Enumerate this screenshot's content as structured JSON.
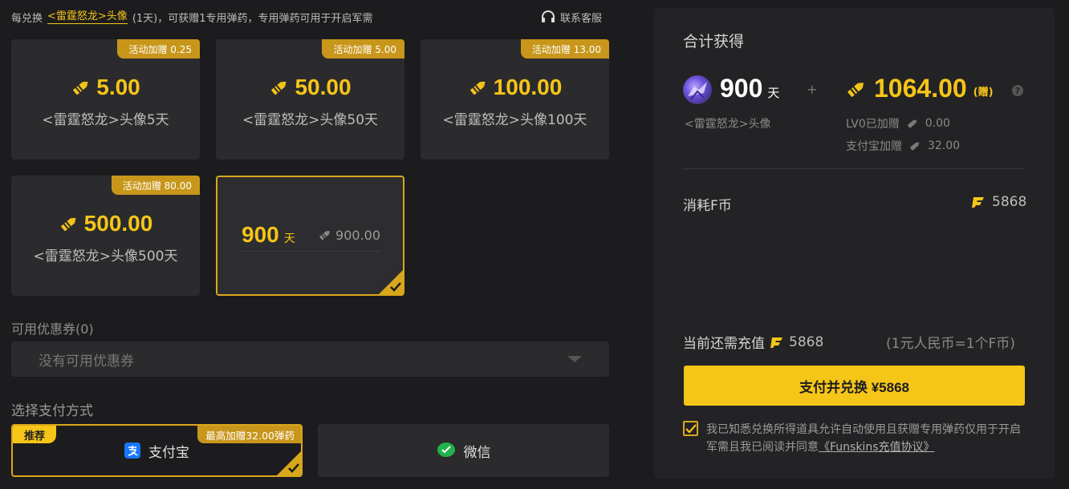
{
  "topline": {
    "prefix": "每兑换",
    "link": "<雷霆怒龙>头像",
    "suffix": "(1天)，可获赠1专用弹药，专用弹药可用于开启军需",
    "service": "联系客服"
  },
  "cards": [
    {
      "badge": "活动加赠 0.25",
      "amount": "5.00",
      "desc": "<雷霆怒龙>头像5天"
    },
    {
      "badge": "活动加赠 5.00",
      "amount": "50.00",
      "desc": "<雷霆怒龙>头像50天"
    },
    {
      "badge": "活动加赠 13.00",
      "amount": "100.00",
      "desc": "<雷霆怒龙>头像100天"
    },
    {
      "badge": "活动加赠 80.00",
      "amount": "500.00",
      "desc": "<雷霆怒龙>头像500天"
    }
  ],
  "custom_card": {
    "days": "900",
    "unit": "天",
    "price": "900.00",
    "selected": true
  },
  "coupon": {
    "label": "可用优惠券(0)",
    "placeholder": "没有可用优惠券"
  },
  "payment": {
    "label": "选择支付方式",
    "methods": [
      {
        "name": "支付宝",
        "recommend": "推荐",
        "bonus": "最高加赠32.00弹药",
        "selected": true
      },
      {
        "name": "微信",
        "selected": false
      }
    ]
  },
  "summary": {
    "title": "合计获得",
    "days": "900",
    "days_unit": "天",
    "plus": "+",
    "item_name": "<雷霆怒龙>头像",
    "total": "1064.00",
    "gift": "(赠)",
    "help": "?",
    "lv_label": "LV0已加赠",
    "lv_value": "0.00",
    "alipay_label": "支付宝加赠",
    "alipay_value": "32.00",
    "consume_label": "消耗F币",
    "consume_value": "5868",
    "need_label": "当前还需充值",
    "need_value": "5868",
    "rate": "(1元人民币=1个F币)",
    "pay_button": "支付并兑换 ¥5868",
    "agreement": "我已知悉兑换所得道具允许自动使用且获赠专用弹药仅用于开启军需且我已阅读并同意",
    "agreement_link": "《Funskins充值协议》",
    "agreed": true
  },
  "colors": {
    "accent": "#f5c518",
    "badge": "#c8961a",
    "bg": "#1c1c1e",
    "card": "#2b2b2d",
    "wechat": "#22b14c",
    "alipay": "#1677ff"
  }
}
